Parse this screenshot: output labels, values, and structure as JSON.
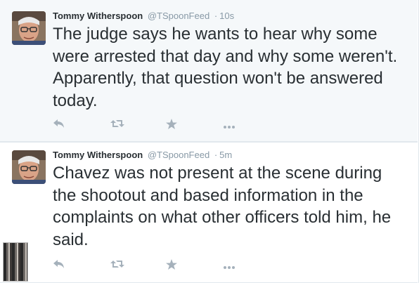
{
  "tweets": [
    {
      "fullname": "Tommy Witherspoon",
      "username": "@TSpoonFeed",
      "separator": "·",
      "time": "10s",
      "text": "The judge says he wants to hear why some were arrested that day and why some weren't. Apparently, that question won't be answered today.",
      "actions": [
        "reply-icon",
        "retweet-icon",
        "favorite-icon",
        "more-icon"
      ]
    },
    {
      "fullname": "Tommy Witherspoon",
      "username": "@TSpoonFeed",
      "separator": "·",
      "time": "5m",
      "text": "Chavez was not present at the scene during the shootout and based information in the complaints on what other officers told him, he said.",
      "actions": [
        "reply-icon",
        "retweet-icon",
        "favorite-icon",
        "more-icon"
      ]
    }
  ],
  "colors": {
    "highlighted_bg": "#f5f8fa",
    "text": "#292f33",
    "muted": "#8899a6",
    "icon": "#a5b1bb",
    "border": "#e1e8ed"
  }
}
